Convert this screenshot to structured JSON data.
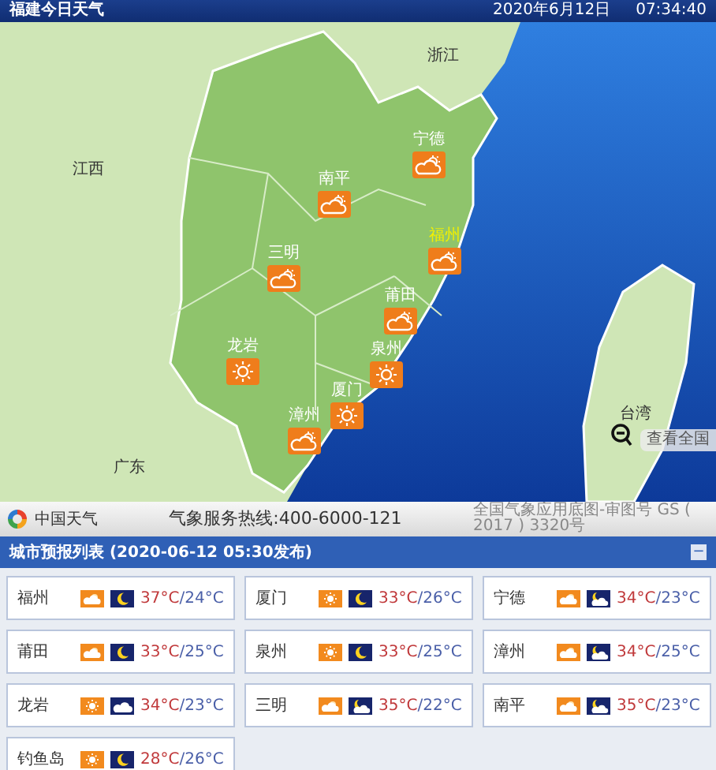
{
  "header": {
    "title": "福建今日天气",
    "date": "2020年6月12日",
    "time": "07:34:40"
  },
  "map": {
    "regions": [
      {
        "name": "浙江"
      },
      {
        "name": "江西"
      },
      {
        "name": "广东"
      },
      {
        "name": "台湾"
      }
    ],
    "cities": [
      {
        "name": "宁德",
        "kind": "partly-cloudy",
        "capital": false
      },
      {
        "name": "南平",
        "kind": "partly-cloudy",
        "capital": false
      },
      {
        "name": "福州",
        "kind": "partly-cloudy",
        "capital": true
      },
      {
        "name": "三明",
        "kind": "partly-cloudy",
        "capital": false
      },
      {
        "name": "莆田",
        "kind": "partly-cloudy",
        "capital": false
      },
      {
        "name": "龙岩",
        "kind": "sunny",
        "capital": false
      },
      {
        "name": "泉州",
        "kind": "sunny",
        "capital": false
      },
      {
        "name": "厦门",
        "kind": "sunny",
        "capital": false
      },
      {
        "name": "漳州",
        "kind": "partly-cloudy",
        "capital": false
      }
    ],
    "national_link": "查看全国"
  },
  "footer": {
    "brand": "中国天气",
    "hotline": "气象服务热线:400-6000-121",
    "approval": "全国气象应用底图-审图号 GS ( 2017 ) 3320号"
  },
  "forecast": {
    "title": "城市预报列表 (2020-06-12 05:30发布)",
    "collapse": "−",
    "cities": [
      {
        "name": "福州",
        "icons": [
          {
            "kind": "partly-cloudy"
          },
          {
            "kind": "moon"
          }
        ],
        "high": "37°C",
        "low": "/24°C"
      },
      {
        "name": "厦门",
        "icons": [
          {
            "kind": "sunny"
          },
          {
            "kind": "moon"
          }
        ],
        "high": "33°C",
        "low": "/26°C"
      },
      {
        "name": "宁德",
        "icons": [
          {
            "kind": "partly-cloudy"
          },
          {
            "kind": "moon-cloud"
          }
        ],
        "high": "34°C",
        "low": "/23°C"
      },
      {
        "name": "莆田",
        "icons": [
          {
            "kind": "partly-cloudy"
          },
          {
            "kind": "moon"
          }
        ],
        "high": "33°C",
        "low": "/25°C"
      },
      {
        "name": "泉州",
        "icons": [
          {
            "kind": "sunny"
          },
          {
            "kind": "moon"
          }
        ],
        "high": "33°C",
        "low": "/25°C"
      },
      {
        "name": "漳州",
        "icons": [
          {
            "kind": "partly-cloudy"
          },
          {
            "kind": "moon-cloud"
          }
        ],
        "high": "34°C",
        "low": "/25°C"
      },
      {
        "name": "龙岩",
        "icons": [
          {
            "kind": "sunny"
          },
          {
            "kind": "cloud"
          }
        ],
        "high": "34°C",
        "low": "/23°C"
      },
      {
        "name": "三明",
        "icons": [
          {
            "kind": "partly-cloudy"
          },
          {
            "kind": "moon-cloud"
          }
        ],
        "high": "35°C",
        "low": "/22°C"
      },
      {
        "name": "南平",
        "icons": [
          {
            "kind": "partly-cloudy"
          },
          {
            "kind": "moon-cloud"
          }
        ],
        "high": "35°C",
        "low": "/23°C"
      },
      {
        "name": "钓鱼岛",
        "icons": [
          {
            "kind": "sunny"
          },
          {
            "kind": "moon"
          }
        ],
        "high": "28°C",
        "low": "/26°C"
      }
    ]
  }
}
